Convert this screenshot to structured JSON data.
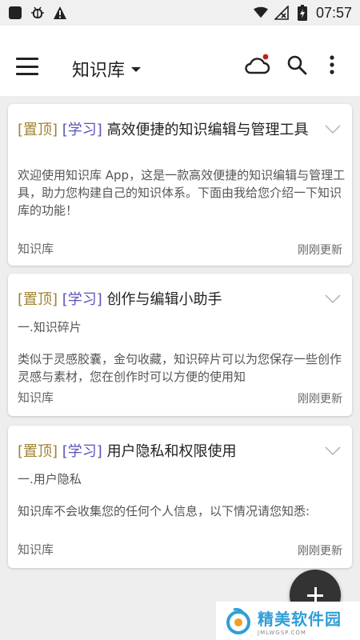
{
  "status_bar": {
    "time": "07:57",
    "icons": [
      "stop-icon",
      "bug-icon",
      "warning-icon",
      "wifi-icon",
      "no-signal-icon",
      "battery-charging-icon"
    ]
  },
  "app_bar": {
    "title": "知识库",
    "actions": [
      "cloud-sync-icon",
      "search-icon",
      "more-vert-icon"
    ],
    "sync_dot_color": "#b3261e"
  },
  "cards": [
    {
      "tag_top": "[置顶]",
      "tag_category": "[学习]",
      "title": "高效便捷的知识编辑与管理工具",
      "subtitle": "",
      "body": "欢迎使用知识库 App，这是一款高效便捷的知识编辑与管理工具，助力您构建自己的知识体系。下面由我给您介绍一下知识库的功能！",
      "source": "知识库",
      "updated": "刚刚更新"
    },
    {
      "tag_top": "[置顶]",
      "tag_category": "[学习]",
      "title": "创作与编辑小助手",
      "subtitle": "一.知识碎片",
      "body": "类似于灵感胶囊，金句收藏，知识碎片可以为您保存一些创作灵感与素材，您在创作时可以方便的使用知",
      "source": "知识库",
      "updated": "刚刚更新"
    },
    {
      "tag_top": "[置顶]",
      "tag_category": "[学习]",
      "title": "用户隐私和权限使用",
      "subtitle": "一.用户隐私",
      "body": "知识库不会收集您的任何个人信息，以下情况请您知悉:",
      "source": "知识库",
      "updated": "刚刚更新"
    }
  ],
  "watermark": {
    "name": "精美软件园",
    "url": "JMLWGSP.COM"
  },
  "colors": {
    "tag_top": "#a0822e",
    "tag_category": "#5a54b8",
    "fab": "#333333",
    "watermark": "#2f9fd8"
  }
}
